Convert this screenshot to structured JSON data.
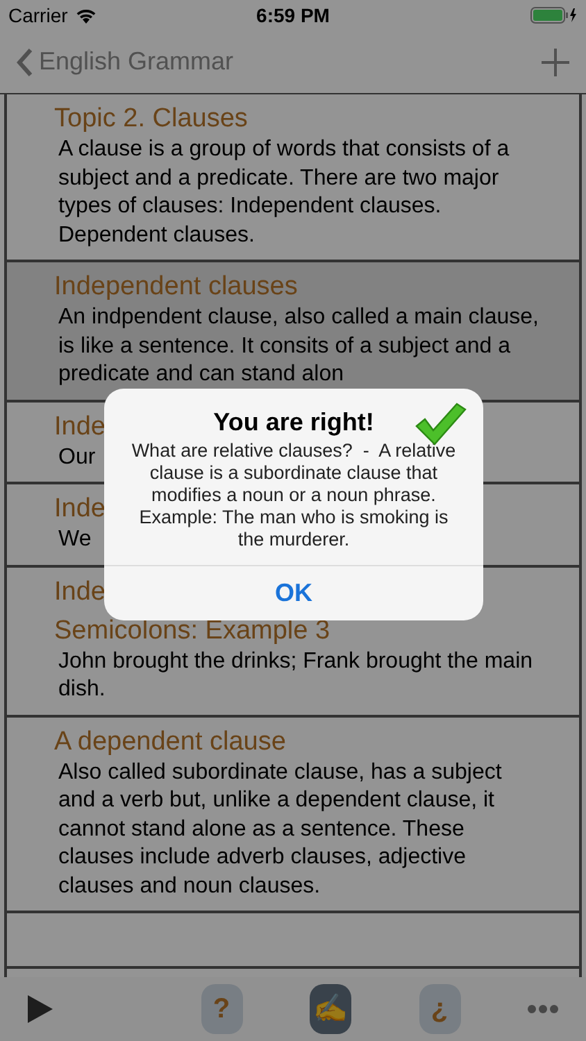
{
  "status_bar": {
    "carrier": "Carrier",
    "time": "6:59 PM"
  },
  "nav": {
    "back_label": "English Grammar"
  },
  "rows": [
    {
      "title": "Topic 2. Clauses",
      "body": "A clause is a group of words that consists of a subject and a predicate. There are two major types of clauses: Independent clauses. Dependent clauses.",
      "selected": false
    },
    {
      "title": "Independent clauses",
      "body": "An indpendent clause, also called a main clause, is like a sentence. It consits of a subject and a predicate and can stand alon",
      "selected": true
    },
    {
      "title": "Inde",
      "body": "Our",
      "selected": false
    },
    {
      "title": "Inde",
      "body": "We",
      "selected": false
    },
    {
      "title": "Inde",
      "subtitle": "Semicolons: Example 3",
      "body": "John brought the drinks; Frank brought the main dish.",
      "selected": false
    },
    {
      "title": "A dependent clause",
      "body": "Also called subordinate clause, has a subject and a verb but, unlike a dependent clause, it cannot stand alone as a sentence. These clauses include adverb clauses, adjective clauses and noun clauses.",
      "selected": false
    },
    {
      "selected": false
    }
  ],
  "alert": {
    "title": "You are right!",
    "message": "What are relative clauses?  -  A relative clause is a subordinate clause that modifies a noun or a noun phrase. Example: The man who is smoking is the murderer.",
    "button": "OK"
  },
  "toolbar": {
    "help": "?",
    "write": "✍",
    "inverted_question": "¿"
  }
}
